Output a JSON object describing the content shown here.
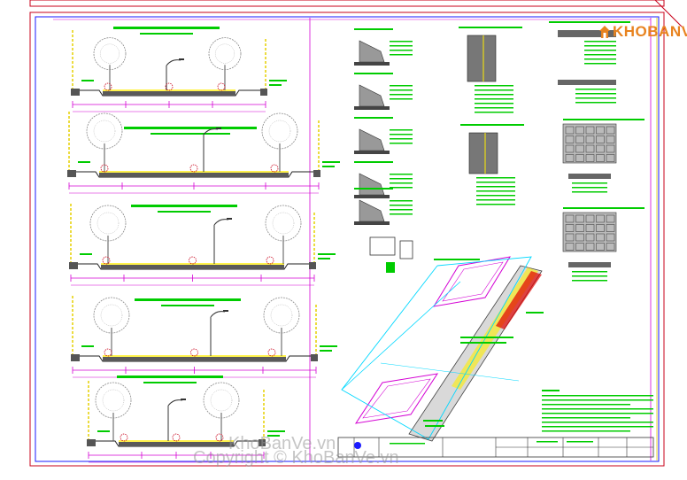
{
  "brand": {
    "logo_text": "KHOBANVE",
    "logo_color": "#e8831f"
  },
  "watermark": {
    "line1": "KhoBanVe.vn",
    "line2": "Copyright © KhoBanVe.vn"
  },
  "colors": {
    "frame_red": "#c8001a",
    "frame_blue": "#1a1aff",
    "frame_magenta": "#d400d4",
    "label_green": "#00cc00",
    "road_gray": "#5a5a5a",
    "highlight_yellow": "#ffee00",
    "cyan_plan": "#00d8ff",
    "tree_gray": "#8a8a8a"
  }
}
